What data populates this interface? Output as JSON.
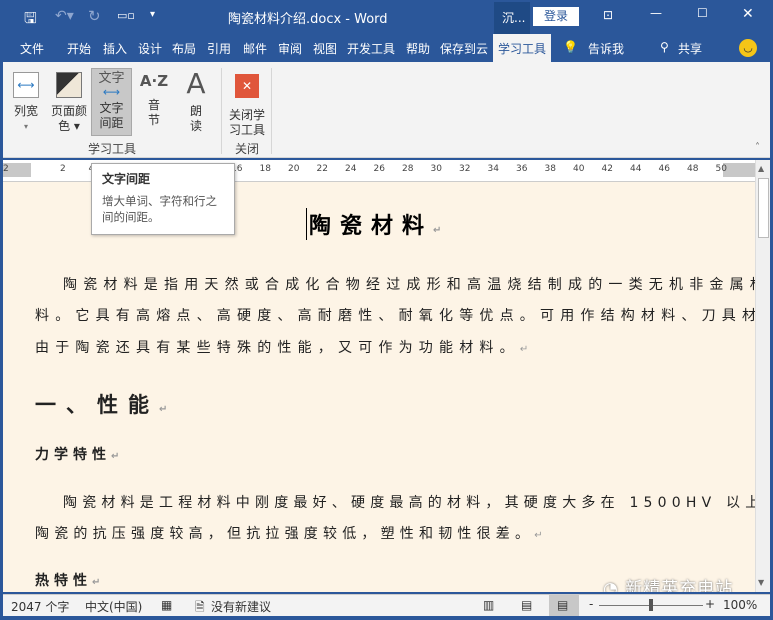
{
  "titlebar": {
    "title": "陶瓷材料介绍.docx  -  Word",
    "account_short": "沉...",
    "login": "登录"
  },
  "tabs": [
    "文件",
    "开始",
    "插入",
    "设计",
    "布局",
    "引用",
    "邮件",
    "审阅",
    "视图",
    "开发工具",
    "帮助",
    "保存到云",
    "学习工具"
  ],
  "active_tab": "学习工具",
  "tell_me": "告诉我",
  "share": "共享",
  "ribbon": {
    "buttons": [
      {
        "label1": "列宽",
        "label2": "▾"
      },
      {
        "label1": "页面颜",
        "label2": "色 ▾"
      },
      {
        "label1": "文字",
        "label2": "间距",
        "icon_text": "文字"
      },
      {
        "label1": "音",
        "label2": "节",
        "icon_text": "A·Z"
      },
      {
        "label1": "朗",
        "label2": "读",
        "icon_text": "A"
      },
      {
        "label1": "关闭学",
        "label2": "习工具"
      }
    ],
    "groups": [
      "学习工具",
      "关闭"
    ]
  },
  "ruler": [
    "2",
    "",
    "2",
    "4",
    "",
    "",
    "",
    "",
    "16",
    "18",
    "20",
    "22",
    "24",
    "26",
    "28",
    "30",
    "32",
    "34",
    "36",
    "38",
    "40",
    "42",
    "44",
    "46",
    "48",
    "50"
  ],
  "tooltip": {
    "title": "文字间距",
    "body": "增大单词、字符和行之间的间距。"
  },
  "document": {
    "title": "陶瓷材料",
    "para1": [
      "陶瓷材料是指用天然或合成化合物经过成形和高温烧结制成的一类无机非金属材",
      "料。它具有高熔点、高硬度、高耐磨性、耐氧化等优点。可用作结构材料、刀具材料，",
      "由于陶瓷还具有某些特殊的性能，又可作为功能材料。"
    ],
    "heading1": "一、性能",
    "heading2": "力学特性",
    "para2": [
      "陶瓷材料是工程材料中刚度最好、硬度最高的材料，其硬度大多在 1500HV 以上。",
      "陶瓷的抗压强度较高，但抗拉强度较低，塑性和韧性很差。"
    ],
    "heading3": "热特性",
    "paragraph_mark": "↵"
  },
  "watermark": "新精英充电站",
  "status": {
    "words": "2047 个字",
    "language": "中文(中国)",
    "proofing": "没有新建议",
    "zoom": "100%",
    "zoom_level": 100
  },
  "colors": {
    "brand": "#2b579a",
    "page": "#fdf4e6",
    "close_red": "#e0563b"
  }
}
